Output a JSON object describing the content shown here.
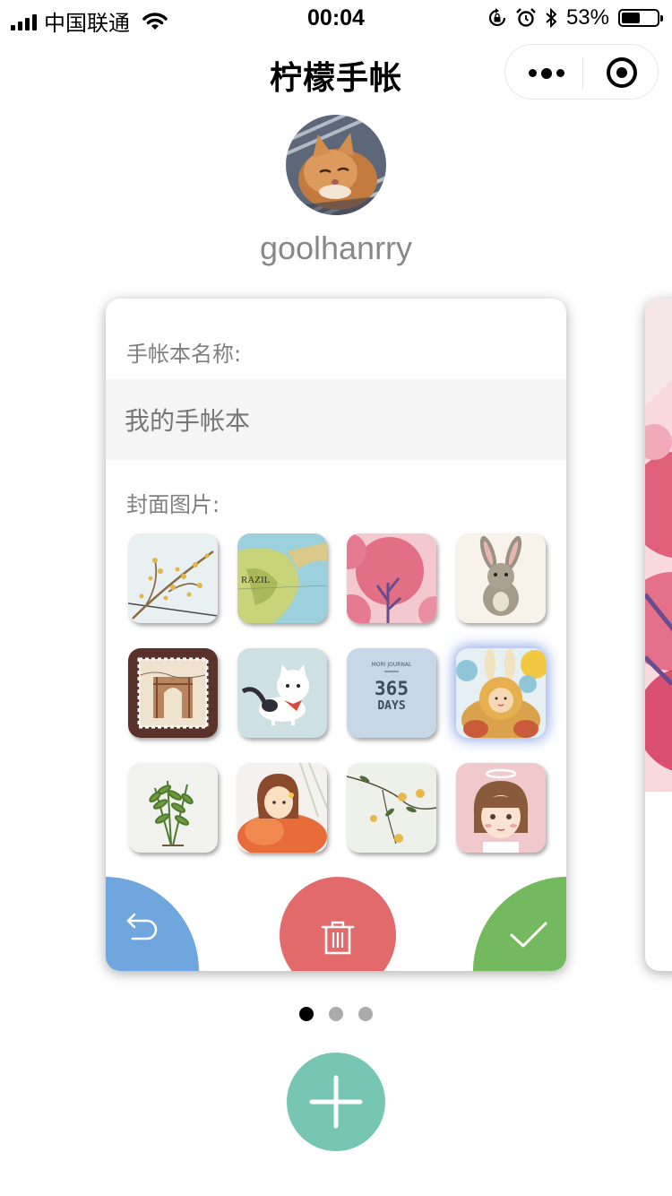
{
  "status": {
    "carrier": "中国联通",
    "time": "00:04",
    "battery_text": "53%",
    "battery_level": 0.53
  },
  "nav": {
    "title": "柠檬手帐"
  },
  "profile": {
    "username": "goolhanrry"
  },
  "notebook": {
    "name_label": "手帐本名称:",
    "name_value": "我的手帐本",
    "cover_label": "封面图片:",
    "covers": [
      {
        "name": "cover-branches"
      },
      {
        "name": "cover-map"
      },
      {
        "name": "cover-pink-tree"
      },
      {
        "name": "cover-rabbit"
      },
      {
        "name": "cover-stamp"
      },
      {
        "name": "cover-cat"
      },
      {
        "name": "cover-365-days"
      },
      {
        "name": "cover-bunny-girl"
      },
      {
        "name": "cover-fern"
      },
      {
        "name": "cover-girl-orange"
      },
      {
        "name": "cover-flowers"
      },
      {
        "name": "cover-angel-girl"
      }
    ],
    "cover_365_small": "MORI JOURNAL",
    "cover_365_big": "365",
    "cover_365_sub": "DAYS",
    "cover_map_text": "RAZIL",
    "selected_cover": 7
  },
  "pager": {
    "count": 3,
    "active": 0
  },
  "colors": {
    "back": "#6fa6de",
    "delete": "#e36a6a",
    "confirm": "#75b95e",
    "add": "#77c6b3"
  },
  "icons": {
    "back": "undo-arrow-icon",
    "delete": "trash-icon",
    "confirm": "check-icon",
    "add": "plus-icon"
  }
}
